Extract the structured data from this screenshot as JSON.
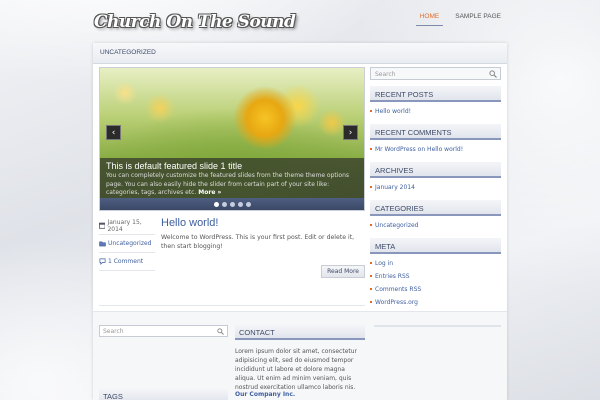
{
  "site": {
    "title": "Church On The Sound"
  },
  "nav": {
    "items": [
      {
        "label": "HOME",
        "active": true
      },
      {
        "label": "SAMPLE PAGE",
        "active": false
      }
    ]
  },
  "category_bar": {
    "label": "UNCATEGORIZED"
  },
  "slider": {
    "title": "This is default featured slide 1 title",
    "text": "You can completely customize the featured slides from the theme theme options page. You can also easily hide the slider from certain part of your site like: categories, tags, archives etc.",
    "more_label": "More »",
    "prev_icon": "‹",
    "next_icon": "›",
    "dots": 5,
    "active_dot": 1
  },
  "post": {
    "date": "January 15, 2014",
    "category": "Uncategorized",
    "comments": "1 Comment",
    "title": "Hello world!",
    "excerpt": "Welcome to WordPress. This is your first post. Edit or delete it, then start blogging!",
    "read_more": "Read More"
  },
  "sidebar": {
    "search_placeholder": "Search",
    "recent_posts": {
      "title": "RECENT POSTS",
      "items": [
        "Hello world!"
      ]
    },
    "recent_comments": {
      "title": "RECENT COMMENTS",
      "items": [
        "Mr WordPress on Hello world!"
      ]
    },
    "archives": {
      "title": "ARCHIVES",
      "items": [
        "January 2014"
      ]
    },
    "categories": {
      "title": "CATEGORIES",
      "items": [
        "Uncategorized"
      ]
    },
    "meta": {
      "title": "META",
      "items": [
        "Log in",
        "Entries RSS",
        "Comments RSS",
        "WordPress.org"
      ]
    }
  },
  "footer": {
    "search_placeholder": "Search",
    "tags_title": "TAGS",
    "contact_title": "CONTACT",
    "contact_text": "Lorem ipsum dolor sit amet, consectetur adipisicing elit, sed do eiusmod tempor incididunt ut labore et dolore magna aliqua. Ut enim ad minim veniam, quis nostrud exercitation ullamco laboris nis.",
    "company": "Our Company Inc."
  },
  "colors": {
    "accent": "#e06d26",
    "link": "#3e5fa0",
    "widget_border": "#8a97bc"
  }
}
